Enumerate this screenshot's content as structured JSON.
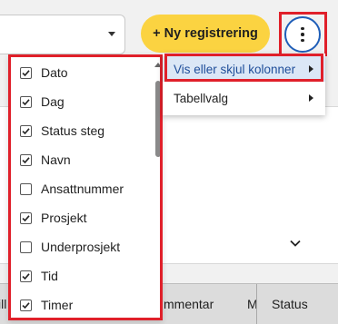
{
  "toolbar": {
    "new_registration_label": "+ Ny registrering",
    "more_options_icon": "kebab-vertical-icon"
  },
  "column_list": {
    "items": [
      {
        "label": "Dato",
        "checked": true
      },
      {
        "label": "Dag",
        "checked": true
      },
      {
        "label": "Status steg",
        "checked": true
      },
      {
        "label": "Navn",
        "checked": true
      },
      {
        "label": "Ansattnummer",
        "checked": false
      },
      {
        "label": "Prosjekt",
        "checked": true
      },
      {
        "label": "Underprosjekt",
        "checked": false
      },
      {
        "label": "Tid",
        "checked": true
      },
      {
        "label": "Timer",
        "checked": true
      }
    ]
  },
  "context_menu": {
    "items": [
      {
        "label": "Vis eller skjul kolonner",
        "active": true
      },
      {
        "label": "Tabellvalg",
        "active": false
      }
    ]
  },
  "table": {
    "headers": [
      "Till",
      "mmentar",
      "M",
      "Status"
    ]
  },
  "colors": {
    "accent_yellow": "#fbd341",
    "highlight_red": "#e0202a",
    "focus_blue": "#1f5eb8",
    "menu_active_bg": "#dbe7f6"
  }
}
